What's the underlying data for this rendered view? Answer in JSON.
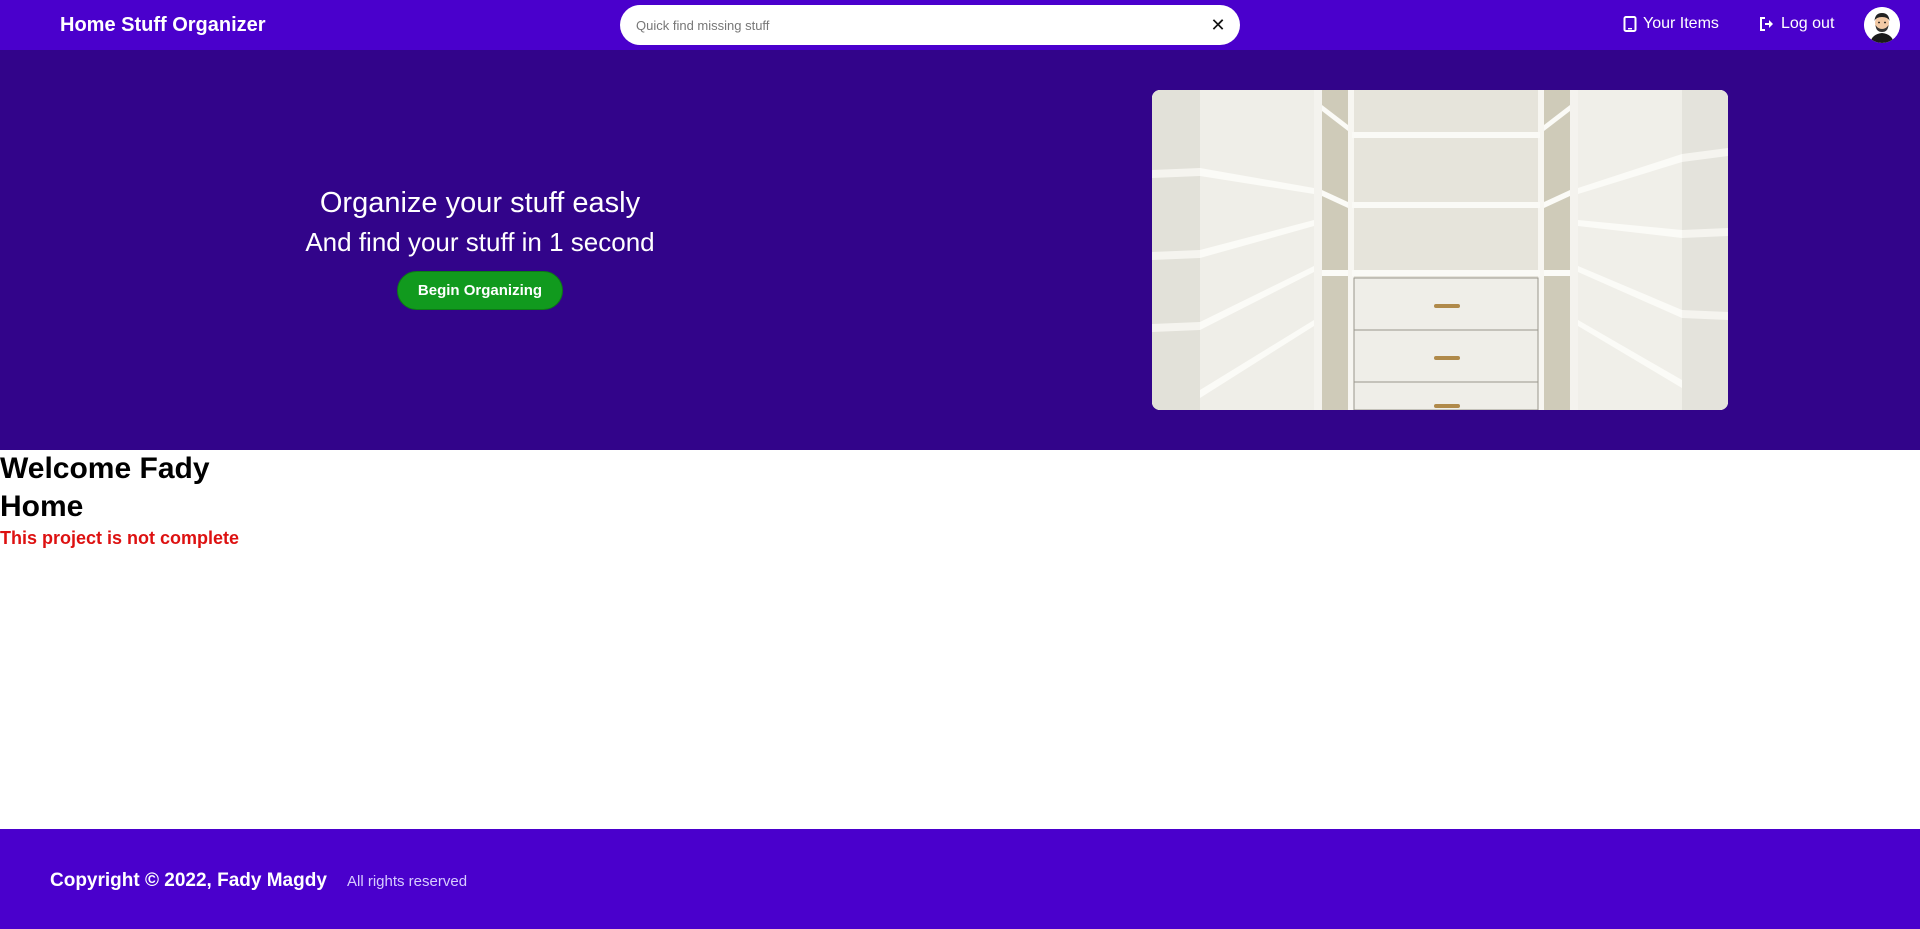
{
  "navbar": {
    "brand": "Home Stuff Organizer",
    "search": {
      "placeholder": "Quick find missing stuff",
      "value": "",
      "clear_icon": "close-icon"
    },
    "links": [
      {
        "label": "Your Items",
        "icon": "tablet-icon"
      },
      {
        "label": "Log out",
        "icon": "logout-icon"
      }
    ],
    "avatar_icon": "user-avatar"
  },
  "hero": {
    "headline": "Organize your stuff easly",
    "subheadline": "And find your stuff in 1 second",
    "cta_label": "Begin Organizing",
    "image": "closet-shelves-photo"
  },
  "main": {
    "welcome": "Welcome Fady",
    "title": "Home",
    "notice": "This project is not complete"
  },
  "footer": {
    "copyright": "Copyright © 2022, Fady Magdy",
    "rights": "All rights reserved"
  },
  "colors": {
    "navbar_bg": "#4a00cc",
    "hero_bg": "#32048a",
    "cta_bg": "#119a1e",
    "notice_text": "#dd1111",
    "footer_bg": "#4a00cc"
  }
}
